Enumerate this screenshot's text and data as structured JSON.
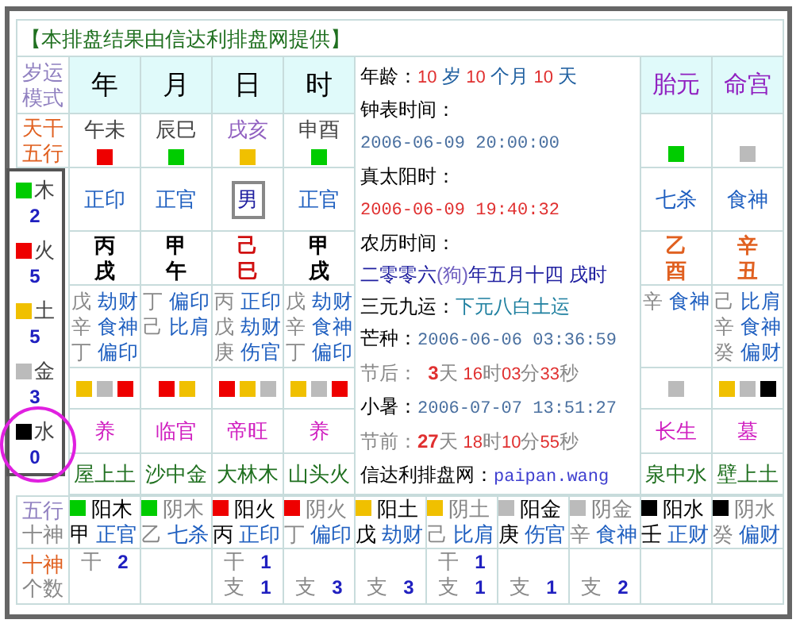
{
  "header": "【本排盘结果由信达利排盘网提供】",
  "corner_label": [
    "岁运",
    "模式"
  ],
  "stem_row_label": [
    "天干",
    "五行"
  ],
  "columns": [
    {
      "kind": "pillar",
      "title": "年",
      "void": "午未",
      "color": "#ee0000",
      "god": "正印",
      "stem": "丙",
      "branch": "戌",
      "hidden": [
        {
          "stem": "戊",
          "god": "劫财"
        },
        {
          "stem": "辛",
          "god": "食神"
        },
        {
          "stem": "丁",
          "god": "偏印"
        }
      ],
      "squares": [
        {
          "color": "#f0c000"
        },
        {
          "color": "#bbbbbb"
        },
        {
          "color": "#ee0000"
        }
      ],
      "phase": "养",
      "nayin": "屋上土"
    },
    {
      "kind": "pillar",
      "title": "月",
      "void": "辰巳",
      "color": "#00cc00",
      "god": "正官",
      "stem": "甲",
      "branch": "午",
      "hidden": [
        {
          "stem": "丁",
          "god": "偏印"
        },
        {
          "stem": "己",
          "god": "比肩"
        }
      ],
      "squares": [
        {
          "color": "#ee0000"
        },
        {
          "color": "#f0c000"
        }
      ],
      "phase": "临官",
      "nayin": "沙中金"
    },
    {
      "kind": "day",
      "title": "日",
      "void": "戌亥",
      "color": "#f0c000",
      "god": "男",
      "stem": "己",
      "branch": "巳",
      "hidden": [
        {
          "stem": "丙",
          "god": "正印"
        },
        {
          "stem": "戊",
          "god": "劫财"
        },
        {
          "stem": "庚",
          "god": "伤官"
        }
      ],
      "squares": [
        {
          "color": "#ee0000"
        },
        {
          "color": "#f0c000"
        },
        {
          "color": "#bbbbbb"
        }
      ],
      "phase": "帝旺",
      "nayin": "大林木"
    },
    {
      "kind": "pillar",
      "title": "时",
      "void": "申酉",
      "color": "#00cc00",
      "god": "正官",
      "stem": "甲",
      "branch": "戌",
      "hidden": [
        {
          "stem": "戊",
          "god": "劫财"
        },
        {
          "stem": "辛",
          "god": "食神"
        },
        {
          "stem": "丁",
          "god": "偏印"
        }
      ],
      "squares": [
        {
          "color": "#f0c000"
        },
        {
          "color": "#bbbbbb"
        },
        {
          "color": "#ee0000"
        }
      ],
      "phase": "养",
      "nayin": "山头火"
    },
    {
      "kind": "extra",
      "title": "胎元",
      "color": "#00cc00",
      "god": "七杀",
      "stem": "乙",
      "branch": "酉",
      "hidden": [
        {
          "stem": "辛",
          "god": "食神"
        }
      ],
      "squares": [
        {
          "color": "#bbbbbb"
        }
      ],
      "phase": "长生",
      "nayin": "泉中水"
    },
    {
      "kind": "extra",
      "title": "命宫",
      "color": "#bbbbbb",
      "god": "食神",
      "stem": "辛",
      "branch": "丑",
      "hidden": [
        {
          "stem": "己",
          "god": "比肩"
        },
        {
          "stem": "辛",
          "god": "食神"
        },
        {
          "stem": "癸",
          "god": "偏财"
        }
      ],
      "squares": [
        {
          "color": "#f0c000"
        },
        {
          "color": "#bbbbbb"
        },
        {
          "color": "#000000"
        }
      ],
      "phase": "墓",
      "nayin": "壁上土"
    }
  ],
  "info": [
    {
      "parts": [
        {
          "text": "年龄：",
          "kind": "label"
        },
        {
          "text": "10 ",
          "kind": "num"
        },
        {
          "text": "岁 ",
          "kind": "unit"
        },
        {
          "text": "10 ",
          "kind": "num"
        },
        {
          "text": "个月 ",
          "kind": "unit"
        },
        {
          "text": "10 ",
          "kind": "num"
        },
        {
          "text": "天",
          "kind": "unit"
        }
      ]
    },
    {
      "parts": [
        {
          "text": "钟表时间：",
          "kind": "label"
        }
      ]
    },
    {
      "parts": [
        {
          "text": "2006-06-09 20:00:00",
          "kind": "date"
        }
      ]
    },
    {
      "parts": [
        {
          "text": "真太阳时：",
          "kind": "label"
        }
      ]
    },
    {
      "parts": [
        {
          "text": "2006-06-09 19:40:32",
          "kind": "date_red"
        }
      ]
    },
    {
      "parts": [
        {
          "text": "农历时间：",
          "kind": "label"
        }
      ]
    },
    {
      "parts": [
        {
          "text": "二零零六",
          "kind": "lunar"
        },
        {
          "text": "(狗)",
          "kind": "lunar_light"
        },
        {
          "text": "年五月十四 戌时",
          "kind": "lunar"
        }
      ]
    },
    {
      "parts": [
        {
          "text": "三元九运：",
          "kind": "label"
        },
        {
          "text": "下元八白土运",
          "kind": "era"
        }
      ]
    },
    {
      "parts": [
        {
          "text": "芒种：",
          "kind": "label"
        },
        {
          "text": "2006-06-06 03:36:59",
          "kind": "date"
        }
      ]
    },
    {
      "parts": [
        {
          "text": "节后：  ",
          "kind": "label_gray"
        },
        {
          "text": "3",
          "kind": "num_bold"
        },
        {
          "text": "天 ",
          "kind": "unit_gray"
        },
        {
          "text": "16",
          "kind": "num"
        },
        {
          "text": "时",
          "kind": "unit_gray"
        },
        {
          "text": "03",
          "kind": "num"
        },
        {
          "text": "分",
          "kind": "unit_gray"
        },
        {
          "text": "33",
          "kind": "num"
        },
        {
          "text": "秒",
          "kind": "unit_gray"
        }
      ]
    },
    {
      "parts": [
        {
          "text": "小暑：",
          "kind": "label"
        },
        {
          "text": "2006-07-07 13:51:27",
          "kind": "date"
        }
      ]
    },
    {
      "parts": [
        {
          "text": "节前：",
          "kind": "label_gray"
        },
        {
          "text": "27",
          "kind": "num_bold"
        },
        {
          "text": "天 ",
          "kind": "unit_gray"
        },
        {
          "text": "18",
          "kind": "num"
        },
        {
          "text": "时",
          "kind": "unit_gray"
        },
        {
          "text": "10",
          "kind": "num"
        },
        {
          "text": "分",
          "kind": "unit_gray"
        },
        {
          "text": "55",
          "kind": "num"
        },
        {
          "text": "秒",
          "kind": "unit_gray"
        }
      ]
    },
    {
      "parts": [
        {
          "text": "信达利排盘网：",
          "kind": "label"
        },
        {
          "text": "paipan.wang",
          "kind": "site"
        }
      ]
    }
  ],
  "wuxing": [
    {
      "name": "木",
      "count": "2",
      "color": "#00cc00",
      "circled": false
    },
    {
      "name": "火",
      "count": "5",
      "color": "#ee0000",
      "circled": false
    },
    {
      "name": "土",
      "count": "5",
      "color": "#f0c000",
      "circled": false
    },
    {
      "name": "金",
      "count": "3",
      "color": "#bbbbbb",
      "circled": false
    },
    {
      "name": "水",
      "count": "0",
      "color": "#000000",
      "circled": true
    }
  ],
  "bottom_labels": [
    [
      "五行",
      "十神"
    ],
    [
      "十神",
      "个数"
    ]
  ],
  "elements": [
    {
      "kind": "yang",
      "color": "#00cc00",
      "name": "阳木",
      "stem": "甲",
      "god": "正官",
      "counts": [
        {
          "kind": "stem",
          "label": "干",
          "value": "2"
        }
      ]
    },
    {
      "kind": "yin",
      "color": "#00cc00",
      "name": "阴木",
      "stem": "乙",
      "god": "七杀"
    },
    {
      "kind": "yang",
      "color": "#ee0000",
      "name": "阳火",
      "stem": "丙",
      "god": "正印",
      "counts": [
        {
          "kind": "stem",
          "label": "干",
          "value": "1"
        },
        {
          "kind": "branch",
          "label": "支",
          "value": "1"
        }
      ]
    },
    {
      "kind": "yin",
      "color": "#ee0000",
      "name": "阴火",
      "stem": "丁",
      "god": "偏印",
      "counts": [
        {
          "kind": "branch",
          "label": "支",
          "value": "3"
        }
      ]
    },
    {
      "kind": "yang",
      "color": "#f0c000",
      "name": "阳土",
      "stem": "戊",
      "god": "劫财",
      "counts": [
        {
          "kind": "branch",
          "label": "支",
          "value": "3"
        }
      ]
    },
    {
      "kind": "yin",
      "color": "#f0c000",
      "name": "阴土",
      "stem": "己",
      "god": "比肩",
      "counts": [
        {
          "kind": "stem",
          "label": "干",
          "value": "1"
        },
        {
          "kind": "branch",
          "label": "支",
          "value": "1"
        }
      ]
    },
    {
      "kind": "yang",
      "color": "#bbbbbb",
      "name": "阳金",
      "stem": "庚",
      "god": "伤官",
      "counts": [
        {
          "kind": "branch",
          "label": "支",
          "value": "1"
        }
      ]
    },
    {
      "kind": "yin",
      "color": "#bbbbbb",
      "name": "阴金",
      "stem": "辛",
      "god": "食神",
      "counts": [
        {
          "kind": "branch",
          "label": "支",
          "value": "2"
        }
      ]
    },
    {
      "kind": "yang",
      "color": "#000000",
      "name": "阳水",
      "stem": "壬",
      "god": "正财"
    },
    {
      "kind": "yin",
      "color": "#000000",
      "name": "阴水",
      "stem": "癸",
      "god": "偏财"
    }
  ]
}
